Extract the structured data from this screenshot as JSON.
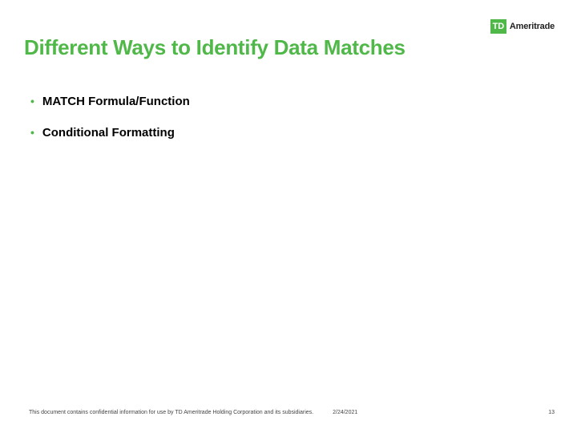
{
  "brand": {
    "mark": "TD",
    "name": "Ameritrade"
  },
  "title": "Different Ways to Identify Data Matches",
  "bullets": [
    "MATCH Formula/Function",
    "Conditional Formatting"
  ],
  "footer": {
    "confidential": "This document contains confidential information for use by TD Ameritrade Holding Corporation and its subsidiaries.",
    "date": "2/24/2021",
    "page": "13"
  }
}
